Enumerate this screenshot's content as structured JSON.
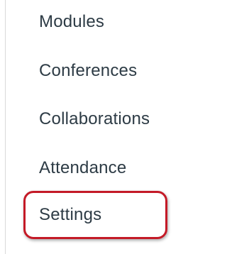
{
  "course_nav": {
    "items": [
      {
        "label": "Modules"
      },
      {
        "label": "Conferences"
      },
      {
        "label": "Collaborations"
      },
      {
        "label": "Attendance"
      },
      {
        "label": "Settings"
      }
    ],
    "highlight_color": "#c41a27",
    "text_color": "#2d3b45"
  }
}
